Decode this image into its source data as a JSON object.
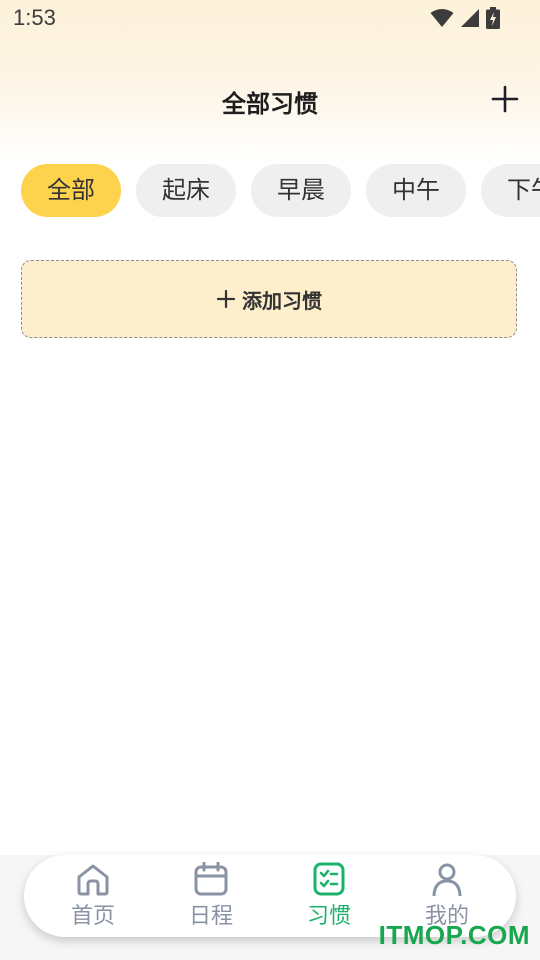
{
  "status_bar": {
    "time": "1:53"
  },
  "header": {
    "title": "全部习惯"
  },
  "tabs": [
    {
      "label": "全部",
      "active": true
    },
    {
      "label": "起床",
      "active": false
    },
    {
      "label": "早晨",
      "active": false
    },
    {
      "label": "中午",
      "active": false
    },
    {
      "label": "下午",
      "active": false
    }
  ],
  "add_habit": {
    "label": "添加习惯"
  },
  "bottom_nav": {
    "items": [
      {
        "label": "首页",
        "icon": "home-icon",
        "active": false
      },
      {
        "label": "日程",
        "icon": "calendar-icon",
        "active": false
      },
      {
        "label": "习惯",
        "icon": "checklist-icon",
        "active": true
      },
      {
        "label": "我的",
        "icon": "person-icon",
        "active": false
      }
    ]
  },
  "watermark": {
    "text": "ITMOP.COM"
  },
  "colors": {
    "accent_yellow": "#fdd34e",
    "card_bg": "#feefcc",
    "active_green": "#1bb36a",
    "inactive_gray": "#8a93a3"
  }
}
